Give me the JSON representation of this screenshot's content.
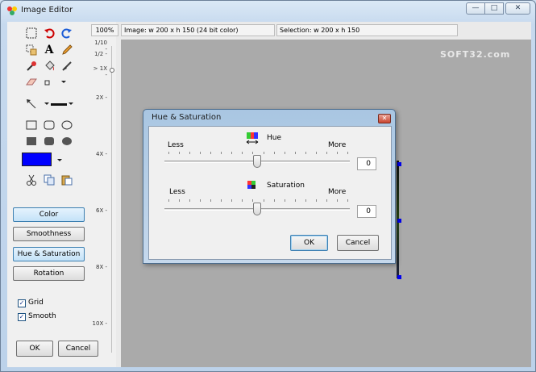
{
  "window": {
    "title": "Image Editor",
    "min_glyph": "—",
    "max_glyph": "□",
    "close_glyph": "✕"
  },
  "status": {
    "zoom": "100%",
    "image_info": "Image:  w 200 x h 150  (24 bit color)",
    "selection_info": "Selection:  w 200 x h 150"
  },
  "ruler": [
    "1/10 -",
    "1/2 -",
    "> 1X -",
    "2X -",
    "4X -",
    "6X -",
    "8X -",
    "10X -"
  ],
  "tools": {
    "primary_color": "#0000ff",
    "text_tool_glyph": "A"
  },
  "side_buttons": {
    "color": "Color",
    "smoothness": "Smoothness",
    "hue_saturation": "Hue & Saturation",
    "rotation": "Rotation"
  },
  "checks": {
    "grid": {
      "label": "Grid",
      "checked": true
    },
    "smooth": {
      "label": "Smooth",
      "checked": true
    }
  },
  "main_buttons": {
    "ok": "OK",
    "cancel": "Cancel"
  },
  "watermark": "SOFT32.com",
  "dialog": {
    "title": "Hue & Saturation",
    "close_glyph": "✕",
    "hue": {
      "label": "Hue",
      "less": "Less",
      "more": "More",
      "value": "0",
      "position": 0.5
    },
    "saturation": {
      "label": "Saturation",
      "less": "Less",
      "more": "More",
      "value": "0",
      "position": 0.5
    },
    "ok": "OK",
    "cancel": "Cancel"
  },
  "colors": {
    "canvas": "#aaaaaa",
    "selection_handle": "#0000ee",
    "primary_swatch": "#0000ff"
  }
}
